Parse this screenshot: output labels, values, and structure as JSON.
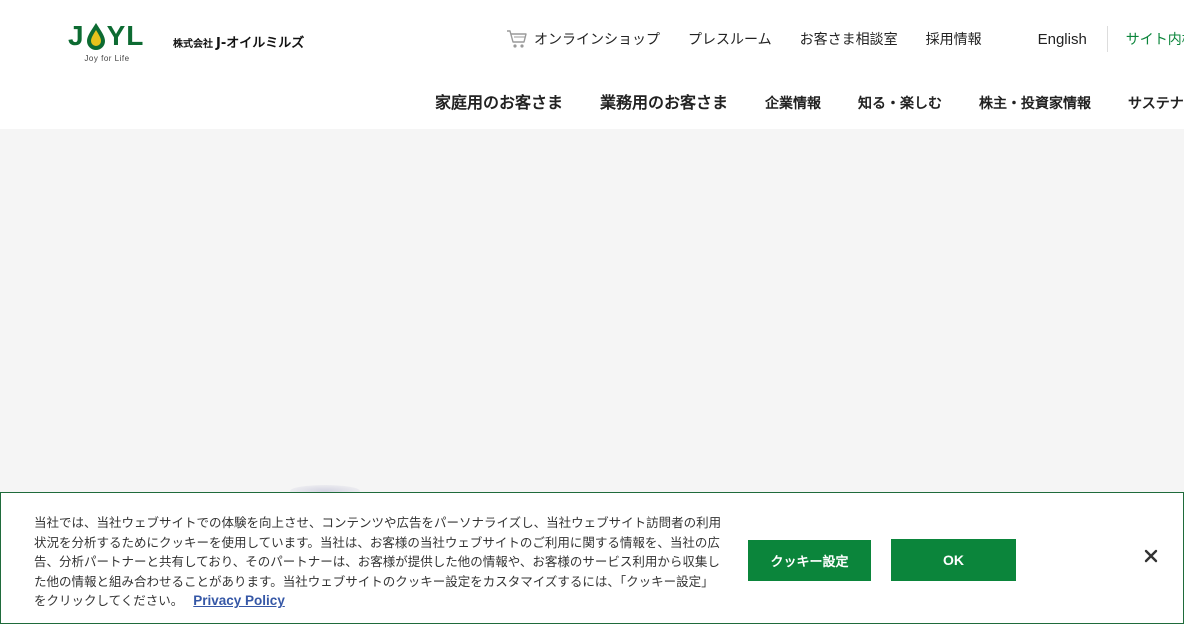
{
  "brand": {
    "logo_letters": [
      "J",
      "Y",
      "L"
    ],
    "tagline": "Joy for Life",
    "company_prefix": "株式会社",
    "company_name": "J-オイルミルズ",
    "brand_green": "#0d6b32"
  },
  "utility_nav": [
    {
      "label": "オンラインショップ",
      "icon": "cart-icon"
    },
    {
      "label": "プレスルーム"
    },
    {
      "label": "お客さま相談室"
    },
    {
      "label": "採用情報"
    },
    {
      "label": "English"
    },
    {
      "label": "サイト内検索"
    }
  ],
  "main_nav": [
    {
      "label": "家庭用のお客さま"
    },
    {
      "label": "業務用のお客さま"
    },
    {
      "label": "企業情報"
    },
    {
      "label": "知る・楽しむ"
    },
    {
      "label": "株主・投資家情報"
    },
    {
      "label": "サステナビリティ"
    }
  ],
  "cookie_banner": {
    "message": "当社では、当社ウェブサイトでの体験を向上させ、コンテンツや広告をパーソナライズし、当社ウェブサイト訪問者の利用状況を分析するためにクッキーを使用しています。当社は、お客様の当社ウェブサイトのご利用に関する情報を、当社の広告、分析パートナーと共有しており、そのパートナーは、お客様が提供した他の情報や、お客様のサービス利用から収集した他の情報と組み合わせることがあります。当社ウェブサイトのクッキー設定をカスタマイズするには、「クッキー設定」をクリックしてください。",
    "privacy_link": "Privacy Policy",
    "settings_button": "クッキー設定",
    "ok_button": "OK",
    "close_icon": "close-icon",
    "accent_color": "#0b853b",
    "link_color": "#3557a6"
  }
}
